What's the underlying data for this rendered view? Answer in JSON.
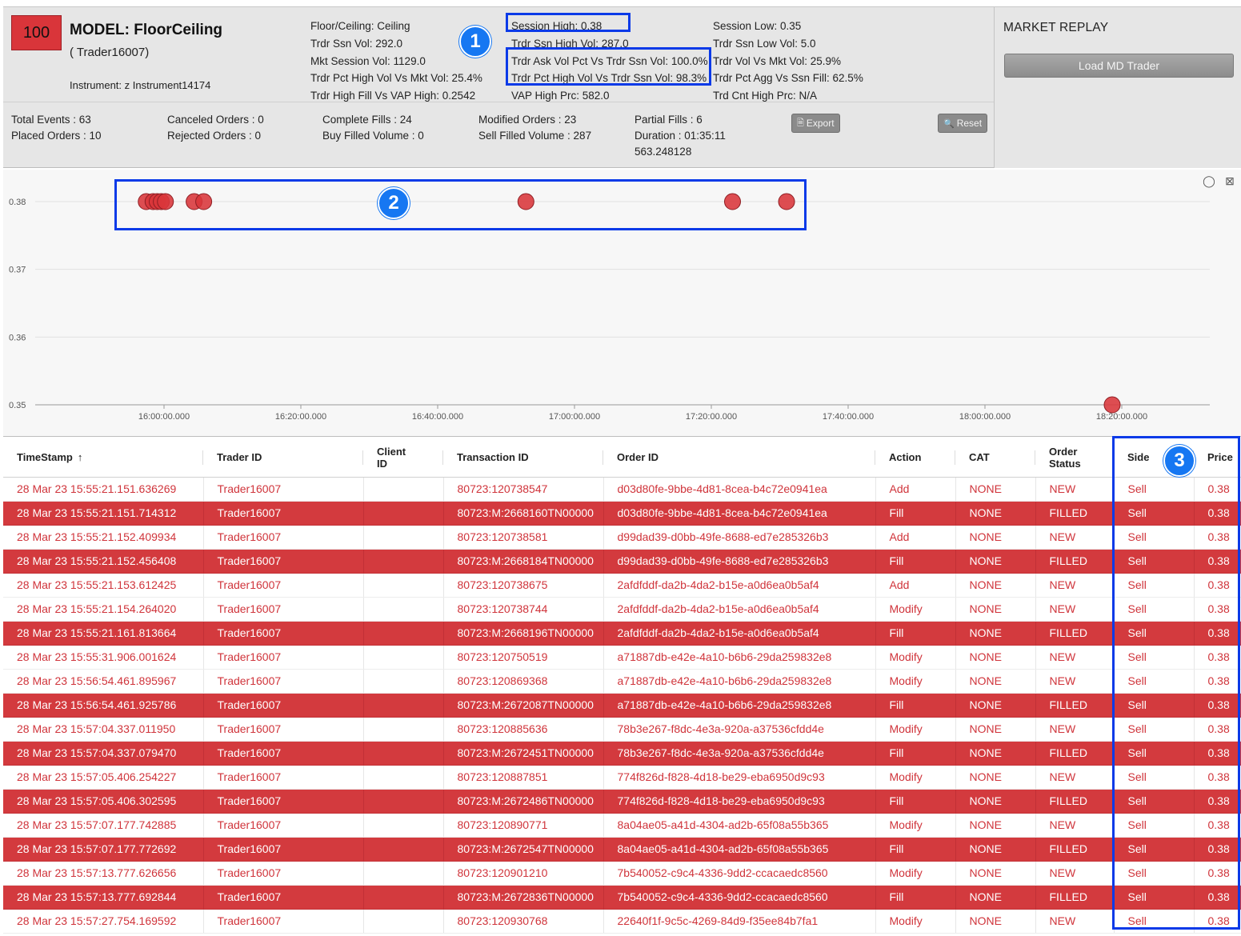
{
  "header": {
    "score": "100",
    "model_title": "MODEL: FloorCeiling",
    "trader": "( Trader16007)",
    "instrument": "Instrument: z Instrument14174",
    "col_a": [
      "Floor/Ceiling: Ceiling",
      "Trdr Ssn Vol: 292.0",
      "Mkt Session Vol: 1129.0",
      "Trdr Pct High Vol Vs Mkt Vol: 25.4%",
      "Trdr High Fill Vs VAP High: 0.2542"
    ],
    "col_b": [
      "Session High: 0.38",
      "Trdr Ssn High Vol: 287.0",
      "Trdr Ask Vol Pct Vs Trdr Ssn Vol: 100.0%",
      "Trdr Pct High Vol Vs Trdr Ssn Vol: 98.3%",
      "VAP High Prc: 582.0"
    ],
    "col_c": [
      "Session Low: 0.35",
      "Trdr Ssn Low Vol: 5.0",
      "Trdr Vol Vs Mkt Vol: 25.9%",
      "Trdr Pct Agg Vs Ssn Fill: 62.5%",
      "Trd Cnt High Prc: N/A"
    ],
    "stats": {
      "total_events": "Total Events : 63",
      "placed_orders": "Placed Orders : 10",
      "canceled_orders": "Canceled Orders : 0",
      "rejected_orders": "Rejected Orders : 0",
      "complete_fills": "Complete Fills : 24",
      "buy_filled": "Buy Filled Volume : 0",
      "modified_orders": "Modified Orders : 23",
      "sell_filled": "Sell Filled Volume : 287",
      "partial_fills": "Partial Fills : 6",
      "duration": "Duration : 01:35:11",
      "duration_extra": "563.248128"
    },
    "export_label": "Export",
    "reset_label": "Reset"
  },
  "replay": {
    "title": "MARKET REPLAY",
    "load_button": "Load MD Trader"
  },
  "chart_data": {
    "type": "scatter",
    "yticks": [
      "0.38",
      "0.37",
      "0.36",
      "0.35"
    ],
    "ylim": [
      0.35,
      0.38
    ],
    "xticks": [
      "16:00:00.000",
      "16:20:00.000",
      "16:40:00.000",
      "17:00:00.000",
      "17:20:00.000",
      "17:40:00.000",
      "18:00:00.000",
      "18:20:00.000"
    ],
    "xlim_minutes": [
      941,
      1077
    ],
    "points": [
      {
        "t": 957.4,
        "y": 0.38
      },
      {
        "t": 958.4,
        "y": 0.38
      },
      {
        "t": 959.0,
        "y": 0.38
      },
      {
        "t": 959.6,
        "y": 0.38
      },
      {
        "t": 960.2,
        "y": 0.38
      },
      {
        "t": 964.4,
        "y": 0.38
      },
      {
        "t": 965.8,
        "y": 0.38
      },
      {
        "t": 1012.9,
        "y": 0.38
      },
      {
        "t": 1043.1,
        "y": 0.38
      },
      {
        "t": 1051.0,
        "y": 0.38
      },
      {
        "t": 1099.2,
        "y": 0.35
      }
    ],
    "point_color": "#d9353a"
  },
  "table": {
    "columns": [
      {
        "label": "TimeStamp",
        "sort": "↑"
      },
      {
        "label": "Trader ID"
      },
      {
        "label": "Client ID"
      },
      {
        "label": "Transaction ID"
      },
      {
        "label": "Order ID"
      },
      {
        "label": "Action"
      },
      {
        "label": "CAT"
      },
      {
        "label": "Order Status"
      },
      {
        "label": "Side"
      },
      {
        "label": "Price"
      }
    ],
    "rows": [
      {
        "style": "light",
        "cells": [
          "28 Mar 23 15:55:21.151.636269",
          "Trader16007",
          "",
          "80723:120738547",
          "d03d80fe-9bbe-4d81-8cea-b4c72e0941ea",
          "Add",
          "NONE",
          "NEW",
          "Sell",
          "0.38"
        ]
      },
      {
        "style": "dark",
        "cells": [
          "28 Mar 23 15:55:21.151.714312",
          "Trader16007",
          "",
          "80723:M:2668160TN00000",
          "d03d80fe-9bbe-4d81-8cea-b4c72e0941ea",
          "Fill",
          "NONE",
          "FILLED",
          "Sell",
          "0.38"
        ]
      },
      {
        "style": "light",
        "cells": [
          "28 Mar 23 15:55:21.152.409934",
          "Trader16007",
          "",
          "80723:120738581",
          "d99dad39-d0bb-49fe-8688-ed7e285326b3",
          "Add",
          "NONE",
          "NEW",
          "Sell",
          "0.38"
        ]
      },
      {
        "style": "dark",
        "cells": [
          "28 Mar 23 15:55:21.152.456408",
          "Trader16007",
          "",
          "80723:M:2668184TN00000",
          "d99dad39-d0bb-49fe-8688-ed7e285326b3",
          "Fill",
          "NONE",
          "FILLED",
          "Sell",
          "0.38"
        ]
      },
      {
        "style": "light",
        "cells": [
          "28 Mar 23 15:55:21.153.612425",
          "Trader16007",
          "",
          "80723:120738675",
          "2afdfddf-da2b-4da2-b15e-a0d6ea0b5af4",
          "Add",
          "NONE",
          "NEW",
          "Sell",
          "0.38"
        ]
      },
      {
        "style": "light",
        "cells": [
          "28 Mar 23 15:55:21.154.264020",
          "Trader16007",
          "",
          "80723:120738744",
          "2afdfddf-da2b-4da2-b15e-a0d6ea0b5af4",
          "Modify",
          "NONE",
          "NEW",
          "Sell",
          "0.38"
        ]
      },
      {
        "style": "dark",
        "cells": [
          "28 Mar 23 15:55:21.161.813664",
          "Trader16007",
          "",
          "80723:M:2668196TN00000",
          "2afdfddf-da2b-4da2-b15e-a0d6ea0b5af4",
          "Fill",
          "NONE",
          "FILLED",
          "Sell",
          "0.38"
        ]
      },
      {
        "style": "light",
        "cells": [
          "28 Mar 23 15:55:31.906.001624",
          "Trader16007",
          "",
          "80723:120750519",
          "a71887db-e42e-4a10-b6b6-29da259832e8",
          "Modify",
          "NONE",
          "NEW",
          "Sell",
          "0.38"
        ]
      },
      {
        "style": "light",
        "cells": [
          "28 Mar 23 15:56:54.461.895967",
          "Trader16007",
          "",
          "80723:120869368",
          "a71887db-e42e-4a10-b6b6-29da259832e8",
          "Modify",
          "NONE",
          "NEW",
          "Sell",
          "0.38"
        ]
      },
      {
        "style": "dark",
        "cells": [
          "28 Mar 23 15:56:54.461.925786",
          "Trader16007",
          "",
          "80723:M:2672087TN00000",
          "a71887db-e42e-4a10-b6b6-29da259832e8",
          "Fill",
          "NONE",
          "FILLED",
          "Sell",
          "0.38"
        ]
      },
      {
        "style": "light",
        "cells": [
          "28 Mar 23 15:57:04.337.011950",
          "Trader16007",
          "",
          "80723:120885636",
          "78b3e267-f8dc-4e3a-920a-a37536cfdd4e",
          "Modify",
          "NONE",
          "NEW",
          "Sell",
          "0.38"
        ]
      },
      {
        "style": "dark",
        "cells": [
          "28 Mar 23 15:57:04.337.079470",
          "Trader16007",
          "",
          "80723:M:2672451TN00000",
          "78b3e267-f8dc-4e3a-920a-a37536cfdd4e",
          "Fill",
          "NONE",
          "FILLED",
          "Sell",
          "0.38"
        ]
      },
      {
        "style": "light",
        "cells": [
          "28 Mar 23 15:57:05.406.254227",
          "Trader16007",
          "",
          "80723:120887851",
          "774f826d-f828-4d18-be29-eba6950d9c93",
          "Modify",
          "NONE",
          "NEW",
          "Sell",
          "0.38"
        ]
      },
      {
        "style": "dark",
        "cells": [
          "28 Mar 23 15:57:05.406.302595",
          "Trader16007",
          "",
          "80723:M:2672486TN00000",
          "774f826d-f828-4d18-be29-eba6950d9c93",
          "Fill",
          "NONE",
          "FILLED",
          "Sell",
          "0.38"
        ]
      },
      {
        "style": "light",
        "cells": [
          "28 Mar 23 15:57:07.177.742885",
          "Trader16007",
          "",
          "80723:120890771",
          "8a04ae05-a41d-4304-ad2b-65f08a55b365",
          "Modify",
          "NONE",
          "NEW",
          "Sell",
          "0.38"
        ]
      },
      {
        "style": "dark",
        "cells": [
          "28 Mar 23 15:57:07.177.772692",
          "Trader16007",
          "",
          "80723:M:2672547TN00000",
          "8a04ae05-a41d-4304-ad2b-65f08a55b365",
          "Fill",
          "NONE",
          "FILLED",
          "Sell",
          "0.38"
        ]
      },
      {
        "style": "light",
        "cells": [
          "28 Mar 23 15:57:13.777.626656",
          "Trader16007",
          "",
          "80723:120901210",
          "7b540052-c9c4-4336-9dd2-ccacaedc8560",
          "Modify",
          "NONE",
          "NEW",
          "Sell",
          "0.38"
        ]
      },
      {
        "style": "dark",
        "cells": [
          "28 Mar 23 15:57:13.777.692844",
          "Trader16007",
          "",
          "80723:M:2672836TN00000",
          "7b540052-c9c4-4336-9dd2-ccacaedc8560",
          "Fill",
          "NONE",
          "FILLED",
          "Sell",
          "0.38"
        ]
      },
      {
        "style": "light",
        "cells": [
          "28 Mar 23 15:57:27.754.169592",
          "Trader16007",
          "",
          "80723:120930768",
          "22640f1f-9c5c-4269-84d9-f35ee84b7fa1",
          "Modify",
          "NONE",
          "NEW",
          "Sell",
          "0.38"
        ]
      }
    ]
  },
  "annotations": [
    "1",
    "2",
    "3"
  ],
  "colors": {
    "accent_red": "#d33a3e",
    "annotation_blue": "#0b3ae8",
    "badge_blue": "#1677f2"
  }
}
